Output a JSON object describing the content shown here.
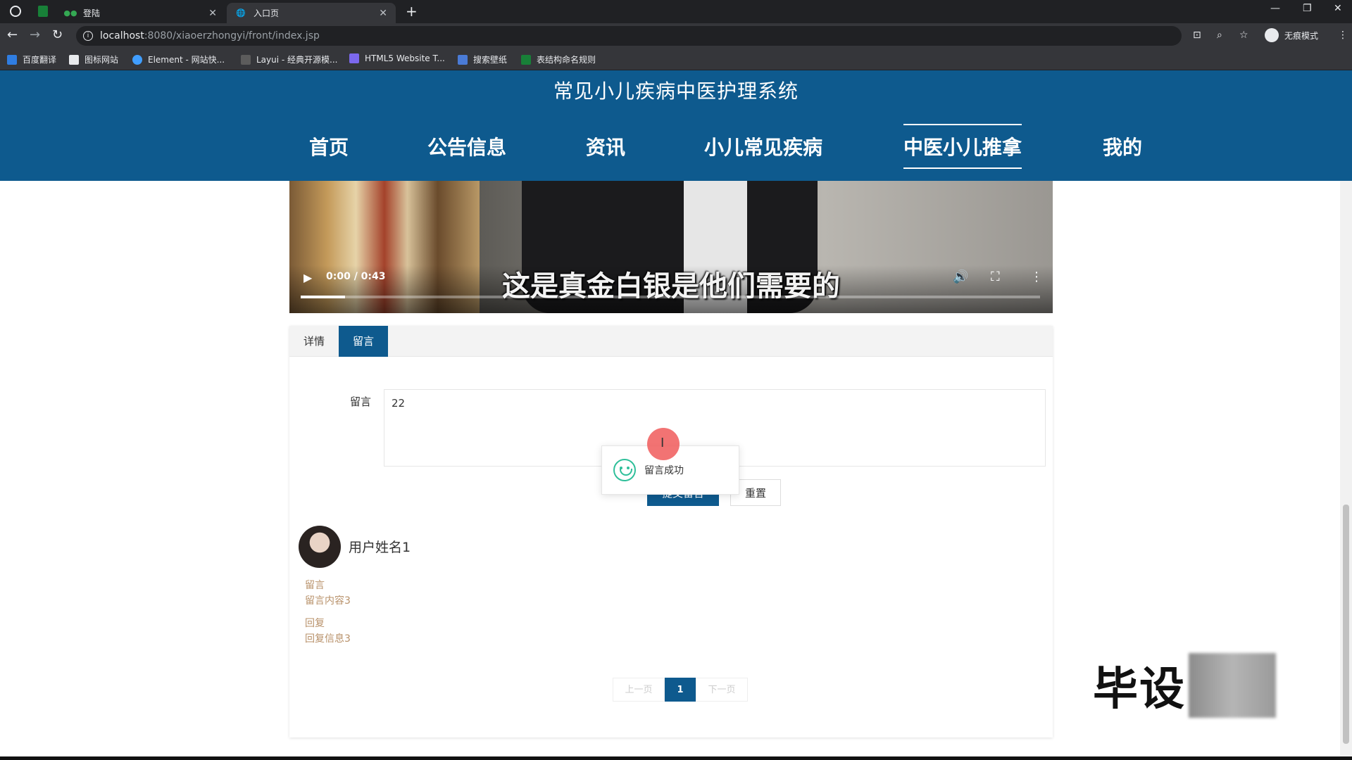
{
  "browser": {
    "tabs": [
      {
        "title": "登陆",
        "active": false
      },
      {
        "title": "入口页",
        "active": true
      }
    ],
    "url_host": "localhost",
    "url_path": ":8080/xiaoerzhongyi/front/index.jsp",
    "incognito_label": "无痕模式",
    "bookmarks": [
      "百度翻译",
      "图标网站",
      "Element - 网站快...",
      "Layui - 经典开源模...",
      "HTML5 Website T...",
      "搜索壁纸",
      "表结构命名规则"
    ]
  },
  "site": {
    "title": "常见小儿疾病中医护理系统",
    "nav": [
      "首页",
      "公告信息",
      "资讯",
      "小儿常见疾病",
      "中医小儿推拿",
      "我的"
    ],
    "active_nav": "中医小儿推拿"
  },
  "video": {
    "time": "0:00 / 0:43",
    "subtitle": "这是真金白银是他们需要的",
    "buffered_fraction": 0.06
  },
  "detail_tabs": [
    "详情",
    "留言"
  ],
  "active_detail_tab": "留言",
  "comment_form": {
    "label": "留言",
    "value": "22",
    "submit_label": "提交留言",
    "reset_label": "重置"
  },
  "toast": {
    "message": "留言成功"
  },
  "comments": [
    {
      "user": "用户姓名1",
      "comment_label": "留言",
      "comment": "留言内容3",
      "reply_label": "回复",
      "reply": "回复信息3"
    }
  ],
  "pagination": {
    "prev": "上一页",
    "current": "1",
    "next": "下一页"
  },
  "watermark": {
    "text": "毕设"
  },
  "colors": {
    "brand": "#0e5a8e",
    "comment_text": "#b8916a",
    "success": "#2fbf9a"
  }
}
